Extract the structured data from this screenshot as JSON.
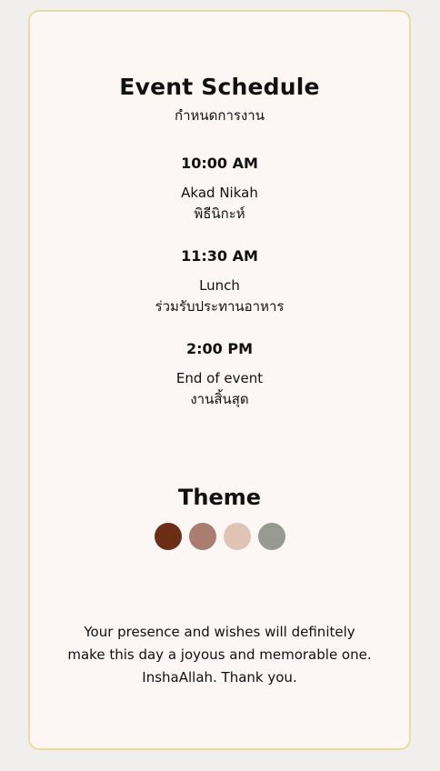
{
  "schedule": {
    "title": "Event Schedule",
    "subtitle": "กำหนดการงาน",
    "events": [
      {
        "time": "10:00 AM",
        "name_en": "Akad Nikah",
        "name_th": "พิธีนิกะห์"
      },
      {
        "time": "11:30 AM",
        "name_en": "Lunch",
        "name_th": "ร่วมรับประทานอาหาร"
      },
      {
        "time": "2:00 PM",
        "name_en": "End of event",
        "name_th": "งานสิ้นสุด"
      }
    ]
  },
  "theme": {
    "title": "Theme",
    "colors": [
      "#6b2e14",
      "#a97e70",
      "#dfc3b5",
      "#979a91"
    ]
  },
  "footer": {
    "line1": "Your presence and wishes will definitely",
    "line2": "make this day a joyous and memorable one.",
    "line3": "InshaAllah. Thank you."
  }
}
